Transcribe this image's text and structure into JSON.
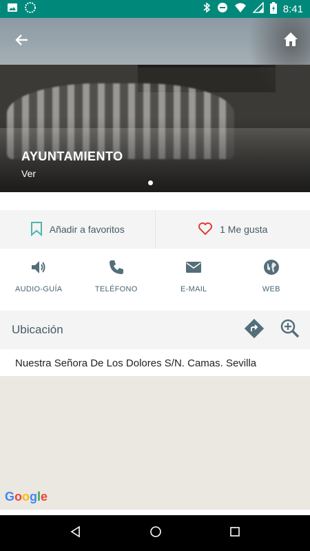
{
  "status_bar": {
    "time": "8:41",
    "icons": [
      "image-icon",
      "circle-app-icon",
      "bluetooth-icon",
      "do-not-disturb-icon",
      "wifi-icon",
      "signal-icon",
      "battery-charging-icon"
    ]
  },
  "hero": {
    "title": "AYUNTAMIENTO",
    "subtitle": "Ver",
    "page_count": 1,
    "active_page": 1
  },
  "actions": {
    "favorites_label": "Añadir a favoritos",
    "likes_label": "1 Me gusta",
    "accent_color": "#4db6ac",
    "like_color": "#e53935"
  },
  "contacts": [
    {
      "label": "AUDIO-GUÍA",
      "icon": "volume-icon"
    },
    {
      "label": "TELÉFONO",
      "icon": "phone-icon"
    },
    {
      "label": "E-MAIL",
      "icon": "mail-icon"
    },
    {
      "label": "WEB",
      "icon": "globe-icon"
    }
  ],
  "location": {
    "title": "Ubicación",
    "address": "Nuestra Señora De Los Dolores S/N. Camas. Sevilla"
  },
  "map": {
    "logo": "Google"
  },
  "colors": {
    "primary": "#00897b",
    "icon": "#546e7a"
  }
}
